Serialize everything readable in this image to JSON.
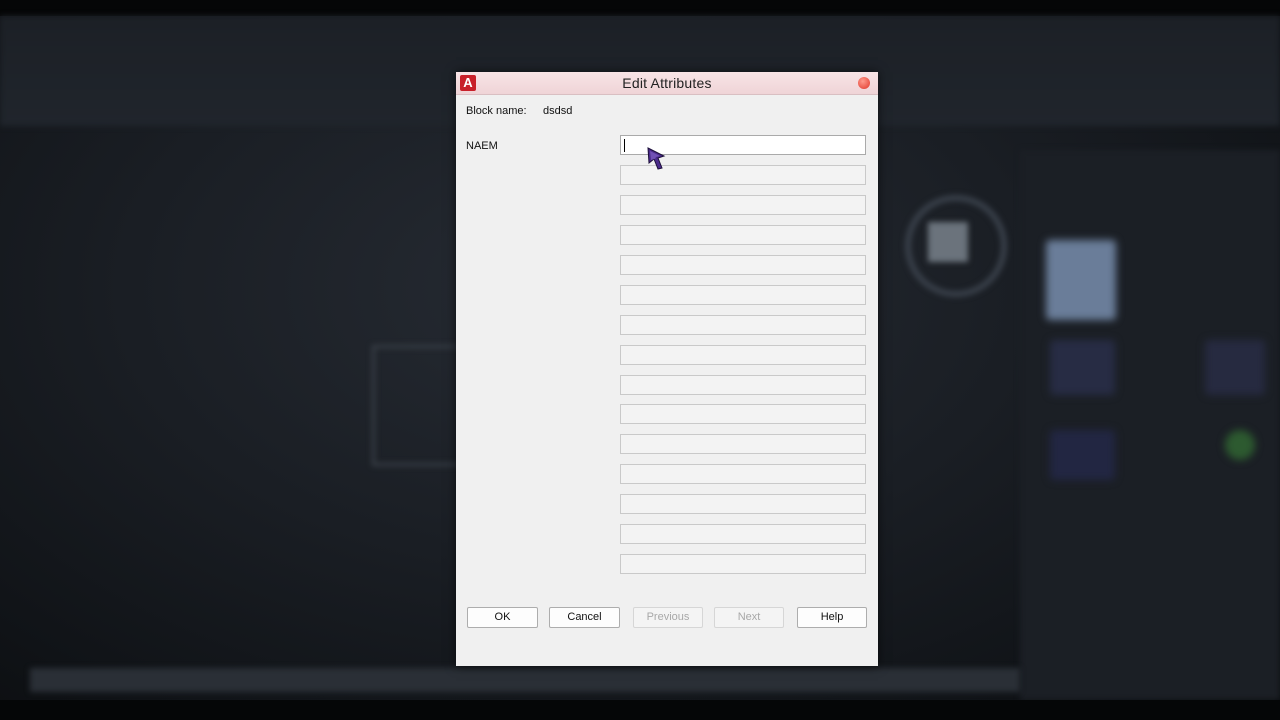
{
  "dialog": {
    "title": "Edit Attributes",
    "app_icon_letter": "A",
    "block_name_label": "Block name:",
    "block_name_value": "dsdsd",
    "attributes": [
      {
        "tag": "NAEM",
        "value": ""
      }
    ],
    "buttons": {
      "ok": "OK",
      "cancel": "Cancel",
      "previous": "Previous",
      "next": "Next",
      "help": "Help"
    }
  },
  "colors": {
    "titlebar": "#efd4d7",
    "dialog_bg": "#f0f0f0",
    "app_icon": "#c8202a",
    "close_button": "#e0362a"
  },
  "icons": {
    "app": "autocad-logo-icon",
    "close": "close-icon",
    "cursor": "mouse-pointer-icon"
  }
}
